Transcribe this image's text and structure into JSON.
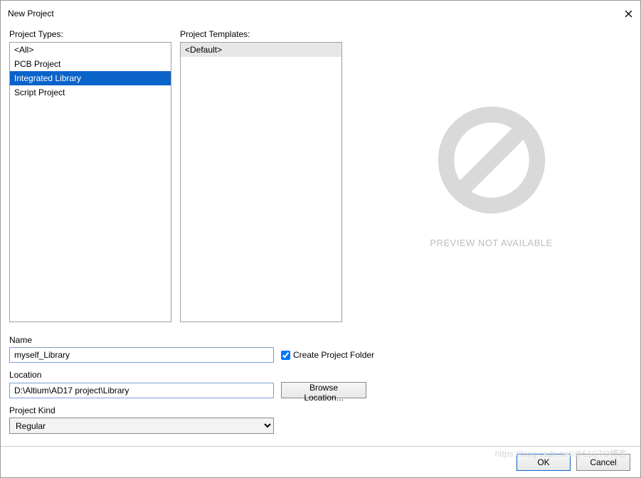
{
  "title": "New Project",
  "sections": {
    "types_label": "Project Types:",
    "templates_label": "Project Templates:"
  },
  "project_types": {
    "items": [
      {
        "label": "<All>"
      },
      {
        "label": "PCB Project"
      },
      {
        "label": "Integrated Library"
      },
      {
        "label": "Script Project"
      }
    ],
    "selected_index": 2
  },
  "project_templates": {
    "items": [
      {
        "label": "<Default>"
      }
    ],
    "selected_index": 0
  },
  "preview": {
    "text": "PREVIEW NOT AVAILABLE"
  },
  "fields": {
    "name_label": "Name",
    "name_value": "myself_Library",
    "create_folder_label": "Create Project Folder",
    "create_folder_checked": true,
    "location_label": "Location",
    "location_value": "D:\\Altium\\AD17 project\\Library",
    "browse_label": "Browse Location...",
    "kind_label": "Project Kind",
    "kind_value": "Regular"
  },
  "buttons": {
    "ok": "OK",
    "cancel": "Cancel"
  },
  "watermark": "https://blog.csdn.net/@51CTO博客"
}
